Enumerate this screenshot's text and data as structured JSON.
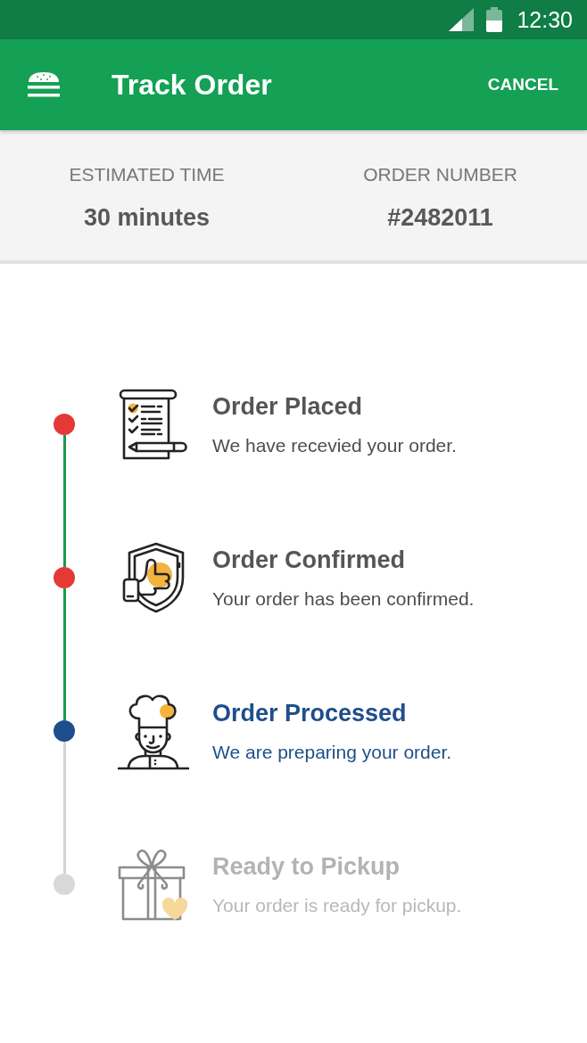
{
  "status_bar": {
    "time": "12:30"
  },
  "app_bar": {
    "title": "Track Order",
    "action": "CANCEL"
  },
  "order_info": [
    {
      "label": "ESTIMATED TIME",
      "value": "30 minutes"
    },
    {
      "label": "ORDER NUMBER",
      "value": "#2482011"
    }
  ],
  "steps": [
    {
      "kind": "checklist",
      "title": "Order Placed",
      "description": "We have recevied your order.",
      "completed": true,
      "current": false
    },
    {
      "kind": "shield",
      "title": "Order Confirmed",
      "description": "Your order has been confirmed.",
      "completed": true,
      "current": false
    },
    {
      "kind": "chef",
      "title": "Order Processed",
      "description": "We are preparing your order.",
      "completed": false,
      "current": true
    },
    {
      "kind": "gift",
      "title": "Ready to Pickup",
      "description": "Your order is ready for pickup.",
      "completed": false,
      "current": false
    }
  ]
}
